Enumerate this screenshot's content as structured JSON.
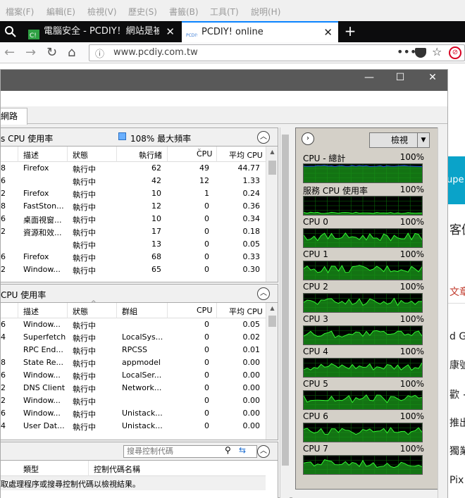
{
  "browser": {
    "menu": [
      "檔案(F)",
      "編輯(E)",
      "檢視(V)",
      "歷史(S)",
      "書籤(B)",
      "工具(T)",
      "說明(H)"
    ],
    "tabs": [
      {
        "title": "電腦安全 - PCDIY！網站是被控",
        "active": false
      },
      {
        "title": "PCDIY! online",
        "active": true
      }
    ],
    "url": "www.pcdiy.com.tw"
  },
  "background_page": {
    "fragments": [
      "upe",
      "客僱",
      "文章",
      "d G",
      "康號",
      "歡 +",
      "推出",
      "獨業",
      "Pix"
    ]
  },
  "task_manager": {
    "window_controls": [
      "—",
      "☐",
      "✕"
    ],
    "tab_network": "網路",
    "cpu_panel_1": {
      "title": "s CPU 使用率",
      "max_freq": "108% 最大頻率",
      "columns": [
        "描述",
        "狀態",
        "執行緒",
        "CPU",
        "平均 CPU"
      ],
      "rows": [
        [
          "8",
          "Firefox",
          "執行中",
          "62",
          "49",
          "44.77"
        ],
        [
          "6",
          "",
          "執行中",
          "42",
          "12",
          "1.33"
        ],
        [
          "2",
          "Firefox",
          "執行中",
          "10",
          "1",
          "0.24"
        ],
        [
          "8",
          "FastSton...",
          "執行中",
          "12",
          "0",
          "0.36"
        ],
        [
          "6",
          "桌面視窗...",
          "執行中",
          "10",
          "0",
          "0.34"
        ],
        [
          "2",
          "資源和效...",
          "執行中",
          "17",
          "0",
          "0.18"
        ],
        [
          "",
          "",
          "執行中",
          "13",
          "0",
          "0.05"
        ],
        [
          "6",
          "Firefox",
          "執行中",
          "68",
          "0",
          "0.33"
        ],
        [
          "2",
          "Window...",
          "執行中",
          "65",
          "0",
          "0.30"
        ]
      ]
    },
    "cpu_panel_2": {
      "title": "CPU 使用率",
      "columns": [
        "描述",
        "狀態",
        "群組",
        "CPU",
        "平均 CPU"
      ],
      "rows": [
        [
          "6",
          "Window...",
          "執行中",
          "",
          "0",
          "0.05"
        ],
        [
          "4",
          "Superfetch",
          "執行中",
          "LocalSys...",
          "0",
          "0.02"
        ],
        [
          "",
          "RPC End...",
          "執行中",
          "RPCSS",
          "0",
          "0.01"
        ],
        [
          "8",
          "State Re...",
          "執行中",
          "appmodel",
          "0",
          "0.00"
        ],
        [
          "6",
          "Window...",
          "執行中",
          "LocalSer...",
          "0",
          "0.00"
        ],
        [
          "2",
          "DNS Client",
          "執行中",
          "Network...",
          "0",
          "0.00"
        ],
        [
          "2",
          "Window...",
          "執行中",
          "",
          "0",
          "0.00"
        ],
        [
          "6",
          "Window...",
          "執行中",
          "Unistack...",
          "0",
          "0.00"
        ],
        [
          "4",
          "User Dat...",
          "執行中",
          "Unistack...",
          "0",
          "0.00"
        ]
      ]
    },
    "handles_panel": {
      "search_placeholder": "搜尋控制代碼",
      "columns": [
        "類型",
        "控制代碼名稱"
      ],
      "message": "取處理程序或搜尋控制代碼以檢視結果。"
    },
    "graphs": {
      "view_label": "檢視",
      "items": [
        {
          "label": "CPU - 總計",
          "pct": "100%"
        },
        {
          "label": "服務 CPU 使用率",
          "pct": "100%"
        },
        {
          "label": "CPU 0",
          "pct": "100%"
        },
        {
          "label": "CPU 1",
          "pct": "100%"
        },
        {
          "label": "CPU 2",
          "pct": "100%"
        },
        {
          "label": "CPU 3",
          "pct": "100%"
        },
        {
          "label": "CPU 4",
          "pct": "100%"
        },
        {
          "label": "CPU 5",
          "pct": "100%"
        },
        {
          "label": "CPU 6",
          "pct": "100%"
        },
        {
          "label": "CPU 7",
          "pct": "100%"
        }
      ]
    }
  },
  "colors": {
    "graph_line": "#33ff33",
    "graph_fill": "#1a9a1a",
    "graph_grid": "#0a6a0a",
    "accent": "#0a84ff"
  }
}
